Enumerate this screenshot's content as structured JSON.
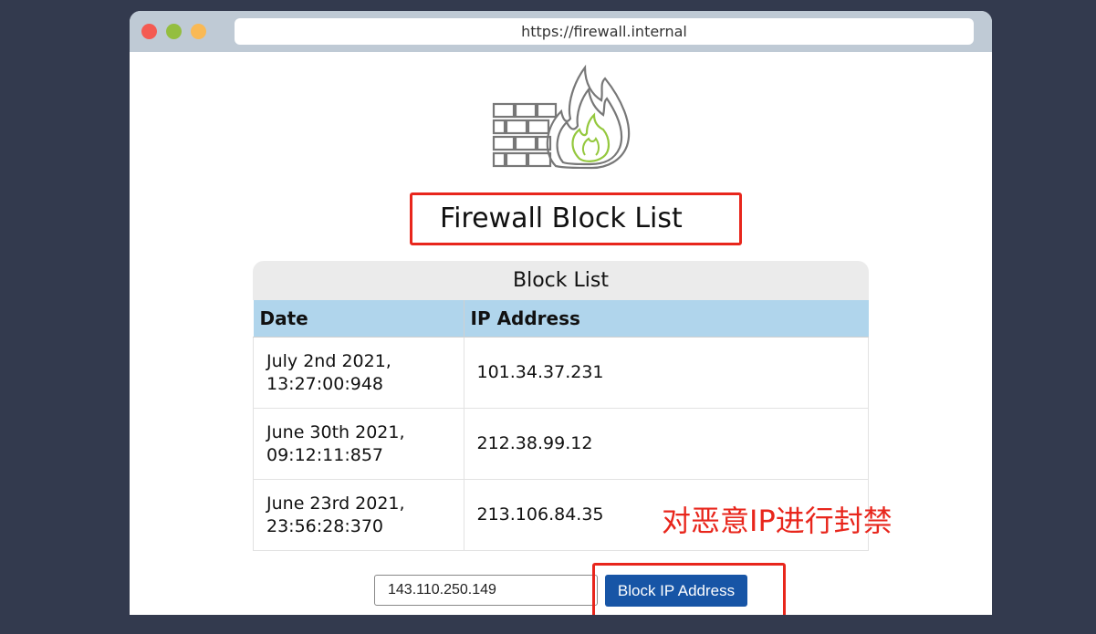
{
  "browser": {
    "url": "https://firewall.internal"
  },
  "page": {
    "title": "Firewall Block List",
    "table": {
      "caption": "Block List",
      "headers": [
        "Date",
        "IP Address"
      ],
      "rows": [
        {
          "date_line1": "July 2nd 2021,",
          "date_line2": "13:27:00:948",
          "ip": "101.34.37.231"
        },
        {
          "date_line1": "June 30th 2021,",
          "date_line2": "09:12:11:857",
          "ip": "212.38.99.12"
        },
        {
          "date_line1": "June 23rd 2021,",
          "date_line2": "23:56:28:370",
          "ip": "213.106.84.35"
        }
      ]
    },
    "form": {
      "ip_value": "143.110.250.149",
      "button_label": "Block IP Address"
    },
    "annotation": "对恶意IP进行封禁"
  },
  "icons": {
    "logo": "firewall-icon"
  },
  "colors": {
    "highlight": "#e8261c",
    "button": "#1755a6",
    "header": "#b0d5ec",
    "flame_inner": "#94c83d"
  }
}
